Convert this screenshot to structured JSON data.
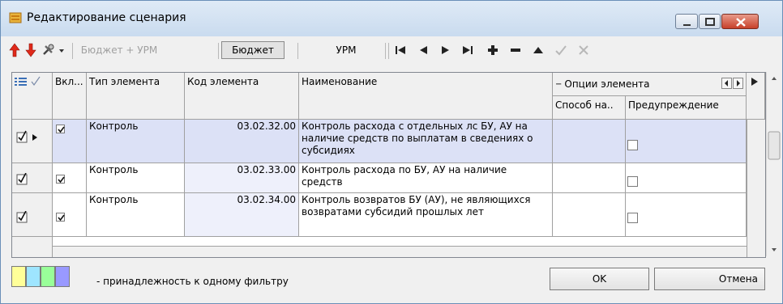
{
  "window": {
    "title": "Редактирование сценария"
  },
  "toolbar": {
    "budget_plus_urm": "Бюджет + УРМ",
    "budget": "Бюджет",
    "urm": "УРМ"
  },
  "grid": {
    "headers": {
      "enabled": "Вкл...",
      "type": "Тип элемента",
      "code": "Код элемента",
      "name": "Наименование",
      "options": "Опции элемента",
      "method": "Способ на..",
      "warning": "Предупреждение"
    },
    "rows": [
      {
        "type": "Контроль",
        "code": "03.02.32.00",
        "name": "Контроль расхода с отдельных лс БУ, АУ на наличие средств по выплатам в сведениях о субсидиях"
      },
      {
        "type": "Контроль",
        "code": "03.02.33.00",
        "name": "Контроль расхода по БУ, АУ на наличие средств"
      },
      {
        "type": "Контроль",
        "code": "03.02.34.00",
        "name": "Контроль возвратов БУ (АУ), не являющихся возвратами субсидий прошлых лет"
      }
    ]
  },
  "footer": {
    "legend_text": "- принадлежность к одному фильтру",
    "ok": "OK",
    "cancel": "Отмена"
  },
  "colors": {
    "selected_row": "#dce1f6",
    "code_column_shade": "#eef0fb",
    "legend": [
      "#ffff99",
      "#9ee5ff",
      "#99ff99",
      "#9999ff"
    ]
  }
}
